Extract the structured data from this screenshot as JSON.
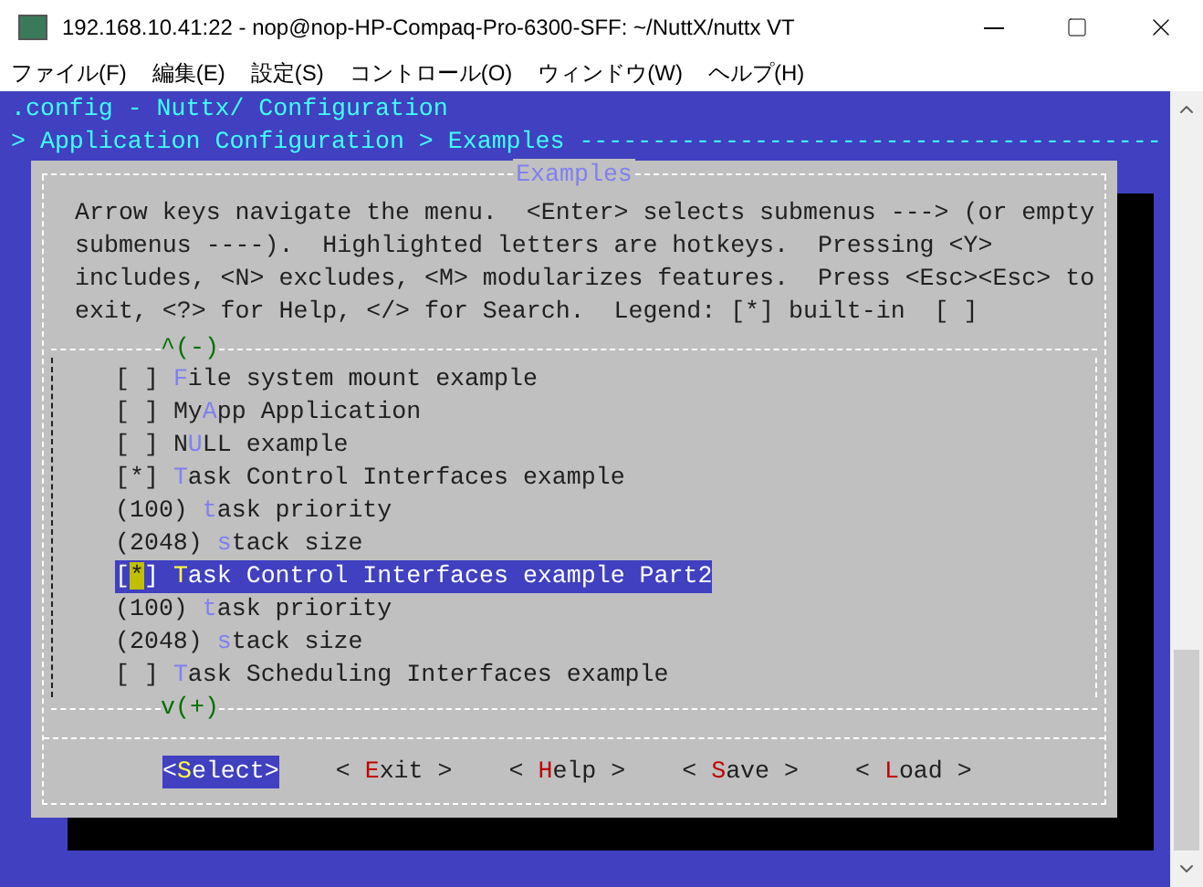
{
  "window": {
    "title": "192.168.10.41:22 - nop@nop-HP-Compaq-Pro-6300-SFF: ~/NuttX/nuttx VT"
  },
  "menu_bar": [
    "ファイル(F)",
    "編集(E)",
    "設定(S)",
    "コントロール(O)",
    "ウィンドウ(W)",
    "ヘルプ(H)"
  ],
  "terminal": {
    "header": [
      ".config - Nuttx/ Configuration",
      "> Application Configuration > Examples ----------------------------------------"
    ],
    "dialog": {
      "title": "Examples",
      "help_lines": [
        "Arrow keys navigate the menu.  <Enter> selects submenus ---> (or empty",
        "submenus ----).  Highlighted letters are hotkeys.  Pressing <Y>",
        "includes, <N> excludes, <M> modularizes features.  Press <Esc><Esc> to",
        "exit, <?> for Help, </> for Search.  Legend: [*] built-in  [ ]"
      ],
      "scroll_up": "^(-)",
      "scroll_down": "v(+)",
      "items": [
        {
          "marker": "[ ]",
          "hotkey": "F",
          "after": "ile system mount example",
          "selected": false
        },
        {
          "marker": "[ ]",
          "before": "My",
          "hotkey": "A",
          "after": "pp Application",
          "selected": false
        },
        {
          "marker": "[ ]",
          "before": "N",
          "hotkey": "U",
          "after": "LL example",
          "selected": false
        },
        {
          "marker": "[*]",
          "hotkey": "T",
          "after": "ask Control Interfaces example",
          "selected": false
        },
        {
          "marker": "(100)",
          "hotkey": "t",
          "after": "ask priority",
          "selected": false
        },
        {
          "marker": "(2048)",
          "hotkey": "s",
          "after": "tack size",
          "selected": false
        },
        {
          "marker": "[*]",
          "hotkey": "T",
          "after": "ask Control Interfaces example Part2",
          "selected": true
        },
        {
          "marker": "(100)",
          "hotkey": "t",
          "after": "ask priority",
          "selected": false
        },
        {
          "marker": "(2048)",
          "hotkey": "s",
          "after": "tack size",
          "selected": false
        },
        {
          "marker": "[ ]",
          "hotkey": "T",
          "after": "ask Scheduling Interfaces example",
          "selected": false
        }
      ],
      "buttons": [
        {
          "open": "<",
          "hotkey": "S",
          "rest": "elect",
          "close": ">",
          "selected": true
        },
        {
          "open": "< ",
          "hotkey": "E",
          "rest": "xit",
          "close": " >",
          "selected": false
        },
        {
          "open": "< ",
          "hotkey": "H",
          "rest": "elp",
          "close": " >",
          "selected": false
        },
        {
          "open": "< ",
          "hotkey": "S",
          "rest": "ave",
          "close": " >",
          "selected": false
        },
        {
          "open": "< ",
          "hotkey": "L",
          "rest": "oad",
          "close": " >",
          "selected": false
        }
      ]
    }
  }
}
